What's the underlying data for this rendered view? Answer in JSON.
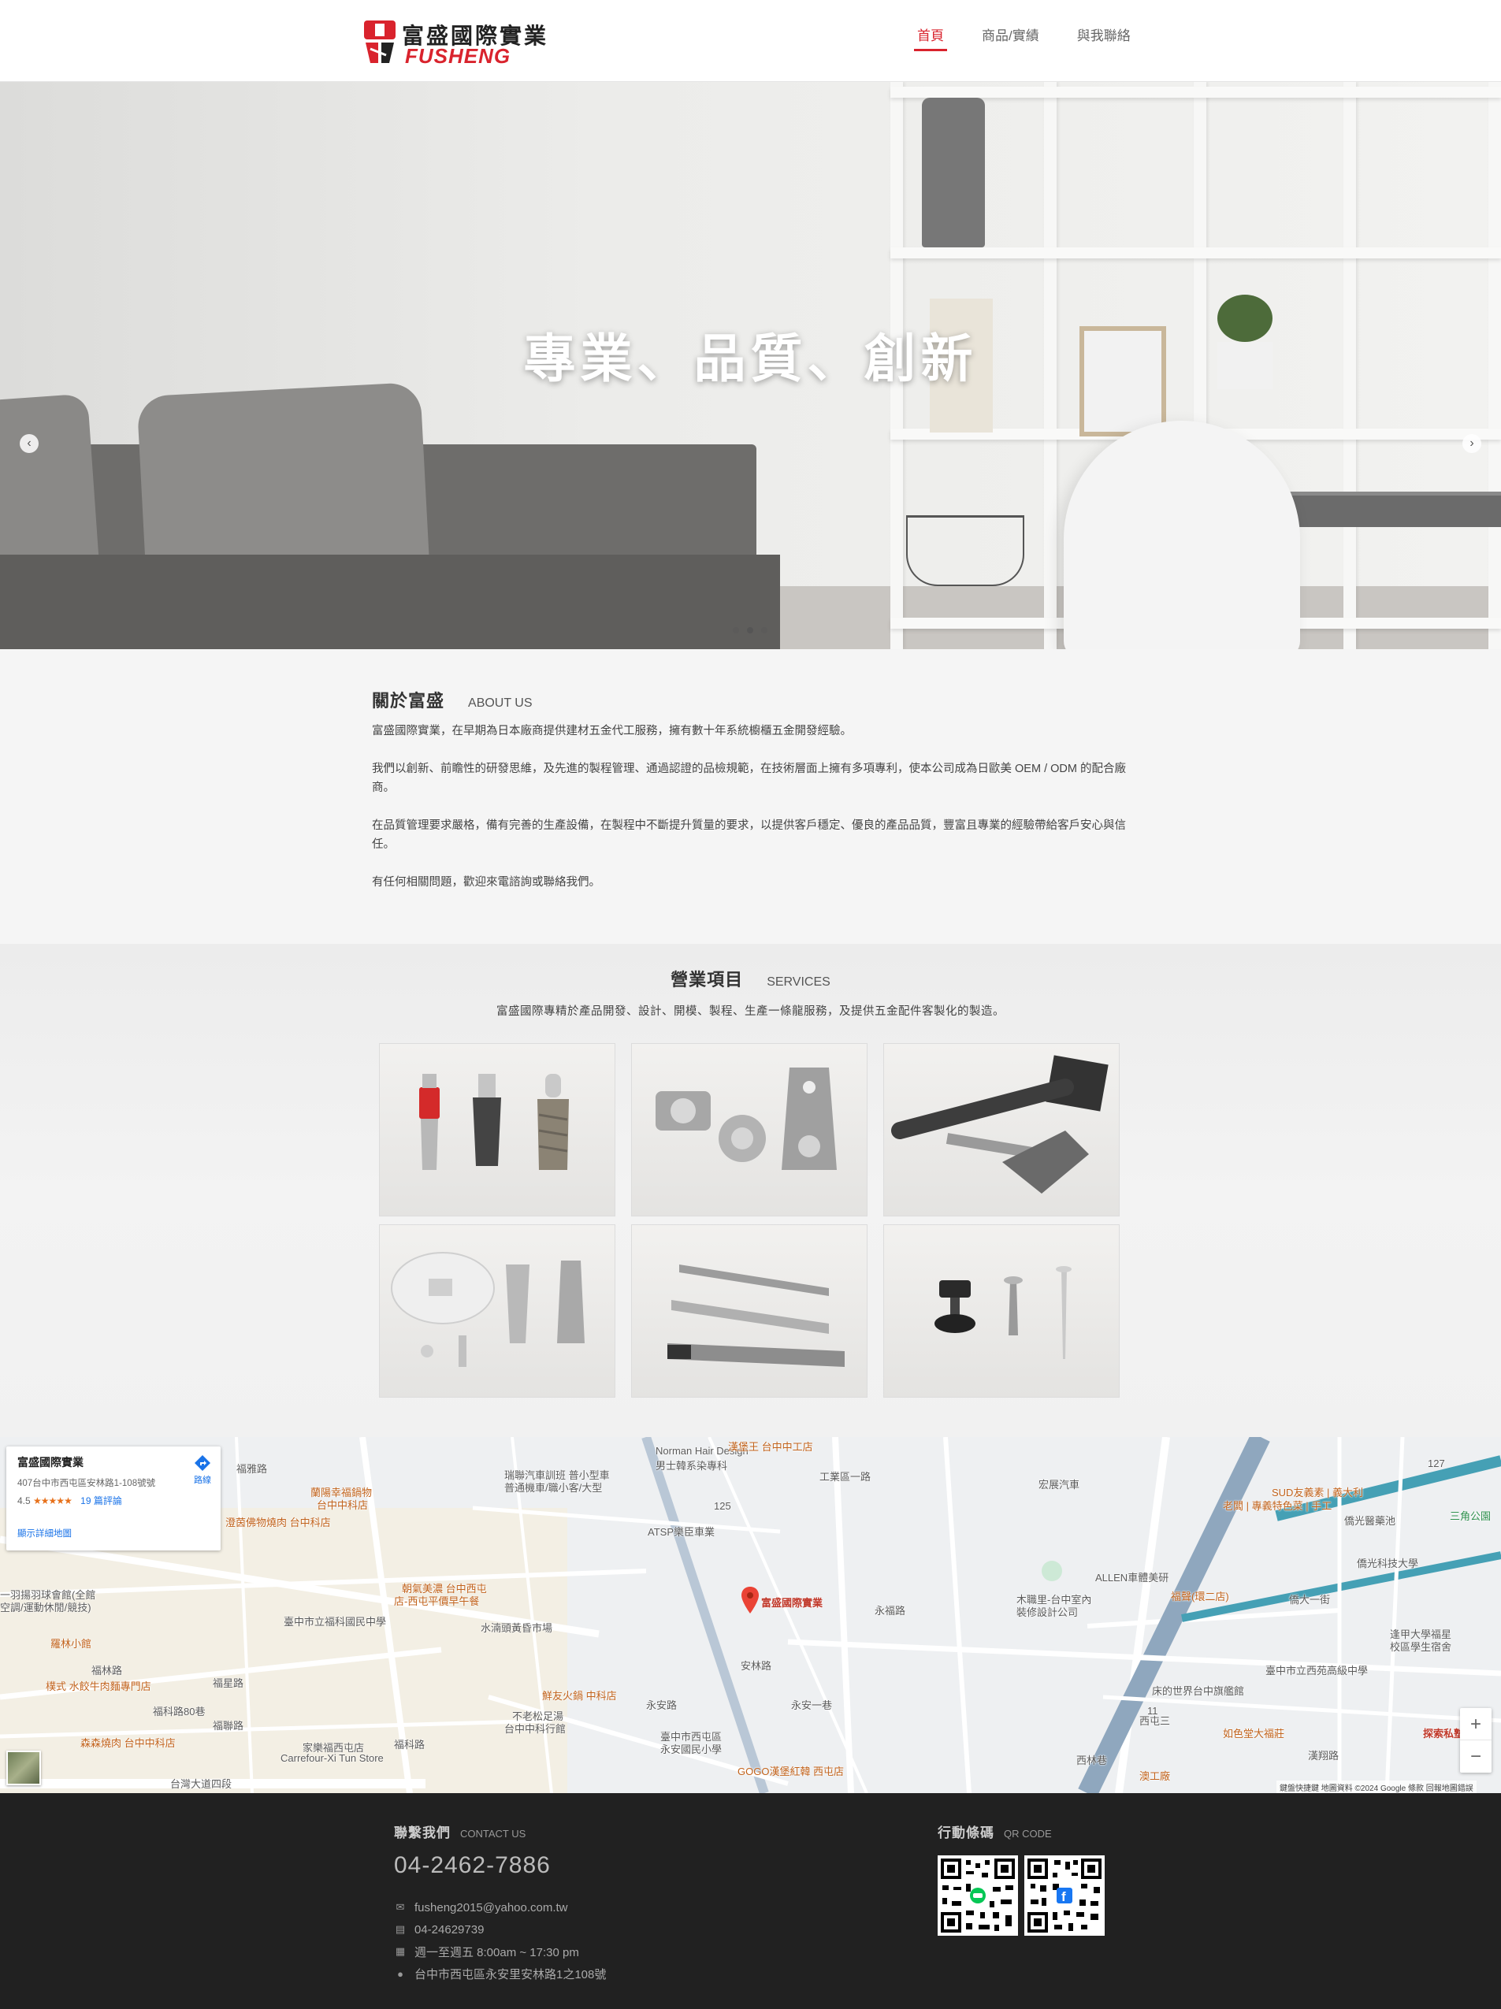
{
  "brand": {
    "name_cn": "富盛國際實業",
    "name_en": "FUSHENG",
    "accent": "#d9232d"
  },
  "nav": {
    "items": [
      {
        "label": "首頁",
        "active": true
      },
      {
        "label": "商品/實績",
        "active": false
      },
      {
        "label": "與我聯絡",
        "active": false
      }
    ]
  },
  "hero": {
    "title": "專業、品質、創新",
    "slide_count": 3,
    "active_slide": 2,
    "prev_icon": "chevron-left-icon",
    "next_icon": "chevron-right-icon"
  },
  "about": {
    "title_cn": "關於富盛",
    "title_en": "ABOUT US",
    "paragraphs": [
      "富盛國際實業，在早期為日本廠商提供建材五金代工服務，擁有數十年系統櫥櫃五金開發經驗。",
      "我們以創新、前瞻性的研發思維，及先進的製程管理、通過認證的品檢規範，在技術層面上擁有多項專利，使本公司成為日歐美 OEM / ODM 的配合廠商。",
      "在品質管理要求嚴格，備有完善的生產設備，在製程中不斷提升質量的要求，以提供客戶穩定、優良的產品品質，豐富且專業的經驗帶給客戶安心與信任。",
      "有任何相關問題，歡迎來電諮詢或聯絡我們。"
    ]
  },
  "services": {
    "title_cn": "營業項目",
    "title_en": "SERVICES",
    "description": "富盛國際專精於產品開發、設計、開模、製程、生產一條龍服務，及提供五金配件客製化的製造。",
    "products": [
      "connector-bolts",
      "cam-locks",
      "table-leg-brackets",
      "shelf-supports",
      "drawer-slides",
      "levelers-screws"
    ]
  },
  "map": {
    "place_name": "富盛國際實業",
    "address": "407台中市西屯區安林路1-108號號",
    "rating": "4.5",
    "stars": "★★★★★",
    "reviews": "19 篇評論",
    "directions_label": "路線",
    "larger_map_link": "顯示詳細地圖",
    "attribution": "鍵盤快捷鍵   地圖資料 ©2024 Google   條款   回報地圖錯誤",
    "zoom_in": "+",
    "zoom_out": "−",
    "labels": [
      "Norman Hair Design",
      "男士韓系染專科",
      "宏展汽車",
      "SUD友義素 | 義大利",
      "老闆 | 專義特色菜 | 手工",
      "僑光醫藥池",
      "僑光科技大學",
      "瑞聯汽車訓班 普小型車",
      "普通機車/職小客/大型",
      "ATSP樂臣車業",
      "富盛國際實業",
      "ALLEN車體美研",
      "木職里-台中室內",
      "裝修設計公司",
      "福聲(環二店)",
      "僑大一街",
      "逢甲大學福星",
      "校區學生宿舍",
      "臺中市立西苑高級中學",
      "床的世界台中旗艦館",
      "如色堂大福莊",
      "漢翔路",
      "探索私塾",
      "西屯三",
      "三角公園",
      "福科路",
      "福林路",
      "臺中市立福科國民中學",
      "水湳頭黃昏市場",
      "朝氣美濃 台中西屯",
      "店-西屯平價早午餐",
      "鮮友火鍋 中科店",
      "不老松足湯",
      "台中中科行館",
      "臺中市西屯區",
      "永安國民小學",
      "家樂福西屯店",
      "Carrefour-Xi Tun Store",
      "森森燒肉 台中中科店",
      "樸式 水餃牛肉麵專門店",
      "羅林小館",
      "台灣大道四段",
      "蘭陽幸福鍋物",
      "台中中科店",
      "澄茵佛物燒肉 台中科店",
      "一羽揚羽球會館(全館",
      "空調/運動休閒/競技)",
      "福星路",
      "福科路80巷",
      "福聯路",
      "安林路",
      "永安一巷",
      "西林巷",
      "工業區一路",
      "澳工廠",
      "福雅路",
      "永福路",
      "永安路",
      "漢堡王 台中中工店",
      "GOGO漢堡紅韓 西屯店",
      "125",
      "127",
      "11"
    ]
  },
  "contact": {
    "title_cn": "聯繫我們",
    "title_en": "CONTACT US",
    "phone": "04-2462-7886",
    "email": "fusheng2015@yahoo.com.tw",
    "fax": "04-24629739",
    "hours": "週一至週五 8:00am ~ 17:30 pm",
    "address": "台中市西屯區永安里安林路1之108號",
    "qr_title_cn": "行動條碼",
    "qr_title_en": "QR CODE"
  }
}
